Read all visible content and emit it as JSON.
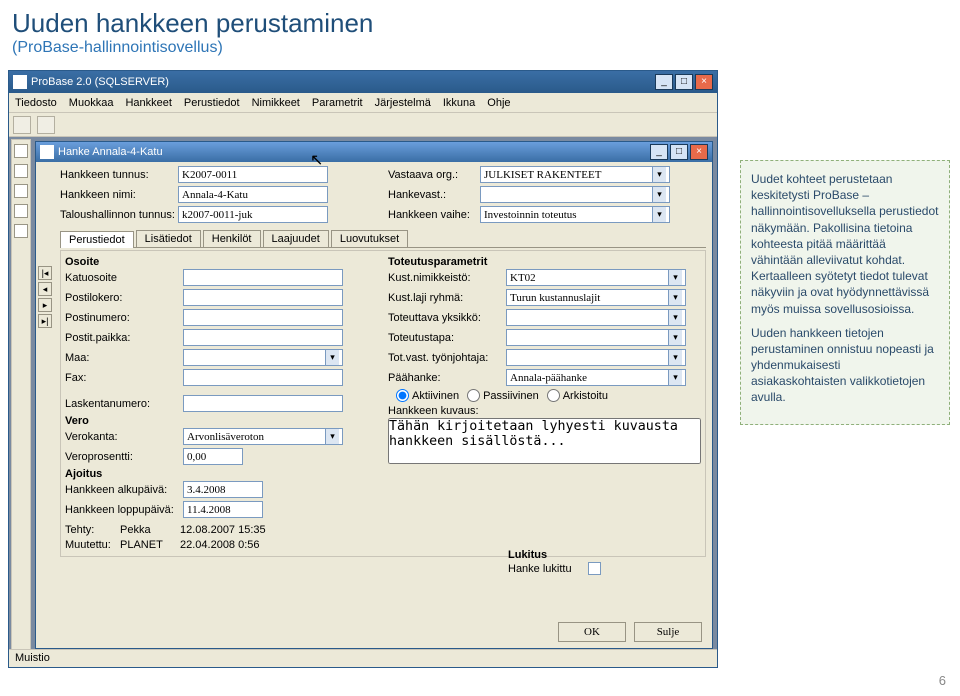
{
  "slide": {
    "title": "Uuden hankkeen perustaminen",
    "subtitle": "(ProBase-hallinnointisovellus)",
    "page": "6"
  },
  "app": {
    "title": "ProBase 2.0 (SQLSERVER)",
    "menu": [
      "Tiedosto",
      "Muokkaa",
      "Hankkeet",
      "Perustiedot",
      "Nimikkeet",
      "Parametrit",
      "Järjestelmä",
      "Ikkuna",
      "Ohje"
    ],
    "statusbar": "Muistio"
  },
  "child": {
    "title": "Hanke Annala-4-Katu"
  },
  "fields": {
    "tunnus_l": "Hankkeen tunnus:",
    "tunnus": "K2007-0011",
    "nimi_l": "Hankkeen nimi:",
    "nimi": "Annala-4-Katu",
    "talous_l": "Taloushallinnon tunnus:",
    "talous": "k2007-0011-juk",
    "vastorg_l": "Vastaava org.:",
    "vastorg": "JULKISET RAKENTEET",
    "hankevast_l": "Hankevast.:",
    "hankevast": "",
    "vaihe_l": "Hankkeen vaihe:",
    "vaihe": "Investoinnin toteutus"
  },
  "tabs": [
    "Perustiedot",
    "Lisätiedot",
    "Henkilöt",
    "Laajuudet",
    "Luovutukset"
  ],
  "left": {
    "osoite_h": "Osoite",
    "katu_l": "Katuosoite",
    "katu": "",
    "postilok_l": "Postilokero:",
    "postilok": "",
    "postinro_l": "Postinumero:",
    "postinro": "",
    "postitp_l": "Postit.paikka:",
    "postitp": "",
    "maa_l": "Maa:",
    "maa": "",
    "fax_l": "Fax:",
    "fax": "",
    "lasknro_l": "Laskentanumero:",
    "lasknro": "",
    "vero_h": "Vero",
    "verokanta_l": "Verokanta:",
    "verokanta": "Arvonlisäveroton",
    "veropros_l": "Veroprosentti:",
    "veropros": "0,00",
    "ajoitus_h": "Ajoitus",
    "alku_l": "Hankkeen alkupäivä:",
    "alku": "3.4.2008",
    "loppu_l": "Hankkeen loppupäivä:",
    "loppu": "11.4.2008",
    "tehty_l": "Tehty:",
    "tehty_u": "Pekka",
    "tehty_d": "12.08.2007 15:35",
    "muut_l": "Muutettu:",
    "muut_u": "PLANET",
    "muut_d": "22.04.2008 0:56"
  },
  "right": {
    "param_h": "Toteutusparametrit",
    "kustnim_l": "Kust.nimikkeistö:",
    "kustnim": "KT02",
    "kustlaji_l": "Kust.laji ryhmä:",
    "kustlaji": "Turun kustannuslajit",
    "totyks_l": "Toteuttava yksikkö:",
    "totyks": "",
    "tottapa_l": "Toteutustapa:",
    "tottapa": "",
    "totvast_l": "Tot.vast. työnjohtaja:",
    "totvast": "",
    "paah_l": "Päähanke:",
    "paah": "Annala-päähanke",
    "r1": "Aktiivinen",
    "r2": "Passiivinen",
    "r3": "Arkistoitu",
    "kuvaus_l": "Hankkeen kuvaus:",
    "kuvaus": "Tähän kirjoitetaan lyhyesti kuvausta hankkeen sisällöstä...",
    "lukitus_h": "Lukitus",
    "lukitus_l": "Hanke lukittu",
    "ok": "OK",
    "sulje": "Sulje"
  },
  "note": {
    "p1": "Uudet kohteet perustetaan keskitetysti ProBase – hallinnointisovelluksella perustiedot näkymään. Pakollisina tietoina kohteesta pitää määrittää vähintään alleviivatut kohdat. Kertaalleen syötetyt tiedot tulevat näkyviin ja ovat hyödynnettävissä myös muissa sovellusosioissa.",
    "p2": "Uuden hankkeen tietojen perustaminen onnistuu nopeasti ja yhdenmukaisesti asiakaskohtaisten valikkotietojen avulla."
  }
}
